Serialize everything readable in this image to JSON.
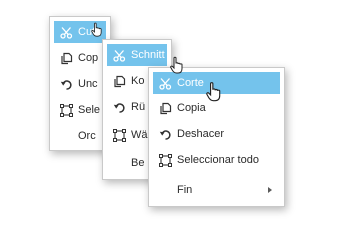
{
  "colors": {
    "highlight": "#74c3ec",
    "border": "#c9c9c9",
    "text": "#2b2b2b"
  },
  "menus": {
    "en": {
      "cut": "Cut",
      "copy": "Cop",
      "undo": "Unc",
      "select_all": "Sele",
      "order": "Orc"
    },
    "de": {
      "cut": "Schnitt",
      "copy": "Ko",
      "undo": "Rü",
      "select_all": "Wä",
      "order": "Be"
    },
    "es": {
      "cut": "Corte",
      "copy": "Copia",
      "undo": "Deshacer",
      "select_all": "Seleccionar todo",
      "order": "Fin"
    }
  },
  "icons": {
    "cut": "scissors-icon",
    "copy": "copy-icon",
    "undo": "undo-icon",
    "select_all": "select-all-icon",
    "submenu": "triangle-right-icon",
    "cursor": "hand-pointer-icon"
  }
}
